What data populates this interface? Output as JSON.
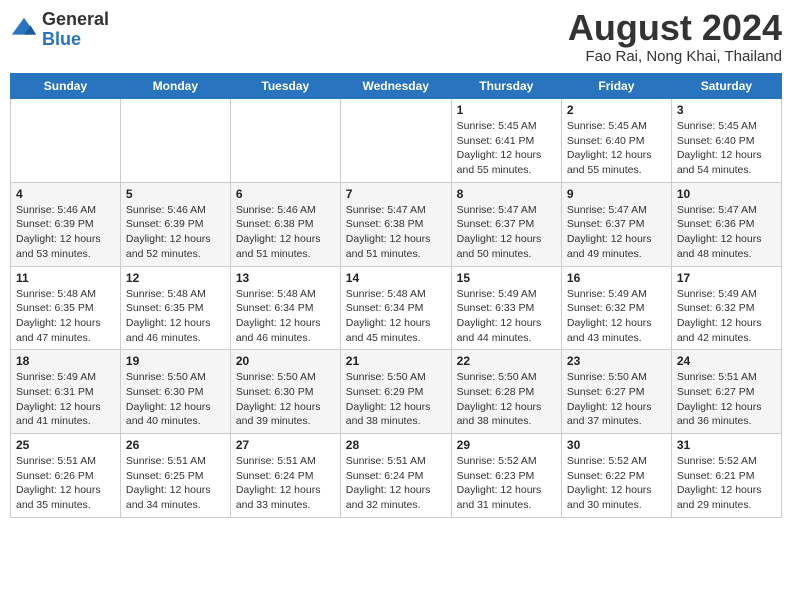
{
  "logo": {
    "text_general": "General",
    "text_blue": "Blue"
  },
  "header": {
    "month_year": "August 2024",
    "location": "Fao Rai, Nong Khai, Thailand"
  },
  "days_of_week": [
    "Sunday",
    "Monday",
    "Tuesday",
    "Wednesday",
    "Thursday",
    "Friday",
    "Saturday"
  ],
  "weeks": [
    [
      {
        "day": "",
        "info": ""
      },
      {
        "day": "",
        "info": ""
      },
      {
        "day": "",
        "info": ""
      },
      {
        "day": "",
        "info": ""
      },
      {
        "day": "1",
        "info": "Sunrise: 5:45 AM\nSunset: 6:41 PM\nDaylight: 12 hours\nand 55 minutes."
      },
      {
        "day": "2",
        "info": "Sunrise: 5:45 AM\nSunset: 6:40 PM\nDaylight: 12 hours\nand 55 minutes."
      },
      {
        "day": "3",
        "info": "Sunrise: 5:45 AM\nSunset: 6:40 PM\nDaylight: 12 hours\nand 54 minutes."
      }
    ],
    [
      {
        "day": "4",
        "info": "Sunrise: 5:46 AM\nSunset: 6:39 PM\nDaylight: 12 hours\nand 53 minutes."
      },
      {
        "day": "5",
        "info": "Sunrise: 5:46 AM\nSunset: 6:39 PM\nDaylight: 12 hours\nand 52 minutes."
      },
      {
        "day": "6",
        "info": "Sunrise: 5:46 AM\nSunset: 6:38 PM\nDaylight: 12 hours\nand 51 minutes."
      },
      {
        "day": "7",
        "info": "Sunrise: 5:47 AM\nSunset: 6:38 PM\nDaylight: 12 hours\nand 51 minutes."
      },
      {
        "day": "8",
        "info": "Sunrise: 5:47 AM\nSunset: 6:37 PM\nDaylight: 12 hours\nand 50 minutes."
      },
      {
        "day": "9",
        "info": "Sunrise: 5:47 AM\nSunset: 6:37 PM\nDaylight: 12 hours\nand 49 minutes."
      },
      {
        "day": "10",
        "info": "Sunrise: 5:47 AM\nSunset: 6:36 PM\nDaylight: 12 hours\nand 48 minutes."
      }
    ],
    [
      {
        "day": "11",
        "info": "Sunrise: 5:48 AM\nSunset: 6:35 PM\nDaylight: 12 hours\nand 47 minutes."
      },
      {
        "day": "12",
        "info": "Sunrise: 5:48 AM\nSunset: 6:35 PM\nDaylight: 12 hours\nand 46 minutes."
      },
      {
        "day": "13",
        "info": "Sunrise: 5:48 AM\nSunset: 6:34 PM\nDaylight: 12 hours\nand 46 minutes."
      },
      {
        "day": "14",
        "info": "Sunrise: 5:48 AM\nSunset: 6:34 PM\nDaylight: 12 hours\nand 45 minutes."
      },
      {
        "day": "15",
        "info": "Sunrise: 5:49 AM\nSunset: 6:33 PM\nDaylight: 12 hours\nand 44 minutes."
      },
      {
        "day": "16",
        "info": "Sunrise: 5:49 AM\nSunset: 6:32 PM\nDaylight: 12 hours\nand 43 minutes."
      },
      {
        "day": "17",
        "info": "Sunrise: 5:49 AM\nSunset: 6:32 PM\nDaylight: 12 hours\nand 42 minutes."
      }
    ],
    [
      {
        "day": "18",
        "info": "Sunrise: 5:49 AM\nSunset: 6:31 PM\nDaylight: 12 hours\nand 41 minutes."
      },
      {
        "day": "19",
        "info": "Sunrise: 5:50 AM\nSunset: 6:30 PM\nDaylight: 12 hours\nand 40 minutes."
      },
      {
        "day": "20",
        "info": "Sunrise: 5:50 AM\nSunset: 6:30 PM\nDaylight: 12 hours\nand 39 minutes."
      },
      {
        "day": "21",
        "info": "Sunrise: 5:50 AM\nSunset: 6:29 PM\nDaylight: 12 hours\nand 38 minutes."
      },
      {
        "day": "22",
        "info": "Sunrise: 5:50 AM\nSunset: 6:28 PM\nDaylight: 12 hours\nand 38 minutes."
      },
      {
        "day": "23",
        "info": "Sunrise: 5:50 AM\nSunset: 6:27 PM\nDaylight: 12 hours\nand 37 minutes."
      },
      {
        "day": "24",
        "info": "Sunrise: 5:51 AM\nSunset: 6:27 PM\nDaylight: 12 hours\nand 36 minutes."
      }
    ],
    [
      {
        "day": "25",
        "info": "Sunrise: 5:51 AM\nSunset: 6:26 PM\nDaylight: 12 hours\nand 35 minutes."
      },
      {
        "day": "26",
        "info": "Sunrise: 5:51 AM\nSunset: 6:25 PM\nDaylight: 12 hours\nand 34 minutes."
      },
      {
        "day": "27",
        "info": "Sunrise: 5:51 AM\nSunset: 6:24 PM\nDaylight: 12 hours\nand 33 minutes."
      },
      {
        "day": "28",
        "info": "Sunrise: 5:51 AM\nSunset: 6:24 PM\nDaylight: 12 hours\nand 32 minutes."
      },
      {
        "day": "29",
        "info": "Sunrise: 5:52 AM\nSunset: 6:23 PM\nDaylight: 12 hours\nand 31 minutes."
      },
      {
        "day": "30",
        "info": "Sunrise: 5:52 AM\nSunset: 6:22 PM\nDaylight: 12 hours\nand 30 minutes."
      },
      {
        "day": "31",
        "info": "Sunrise: 5:52 AM\nSunset: 6:21 PM\nDaylight: 12 hours\nand 29 minutes."
      }
    ]
  ]
}
